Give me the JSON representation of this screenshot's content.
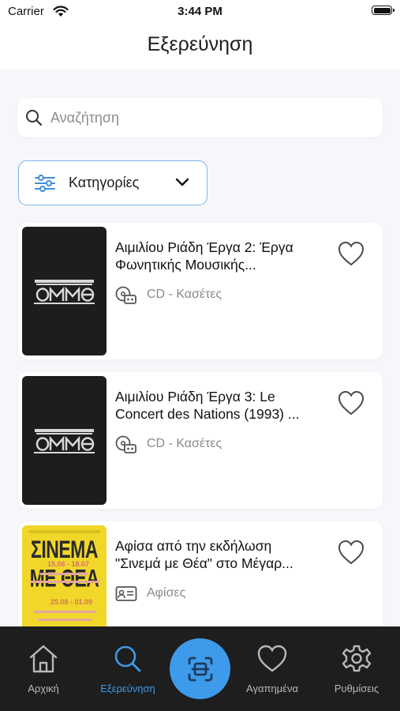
{
  "status_bar": {
    "carrier": "Carrier",
    "time": "3:44 PM"
  },
  "header": {
    "title": "Εξερεύνηση"
  },
  "search": {
    "placeholder": "Αναζήτηση",
    "icon": "search-icon"
  },
  "categories": {
    "label": "Κατηγορίες",
    "icon": "filter-sliders-icon",
    "chevron": "chevron-down-icon"
  },
  "items": [
    {
      "title_line1": "Αιμιλίου Ριάδη Έργα 2: Έργα",
      "title_line2": "Φωνητικής Μουσικής...",
      "category": "CD - Κασέτες",
      "category_icon": "cd-cassette-icon",
      "thumbnail": {
        "style": "dark",
        "logo": "ΟΜΜΘ"
      },
      "favorite": false
    },
    {
      "title_line1": "Αιμιλίου Ριάδη Έργα 3: Le",
      "title_line2": "Concert des Nations (1993) ...",
      "category": "CD - Κασέτες",
      "category_icon": "cd-cassette-icon",
      "thumbnail": {
        "style": "dark",
        "logo": "ΟΜΜΘ"
      },
      "favorite": false
    },
    {
      "title_line1": "Αφίσα από την εκδήλωση",
      "title_line2": "\"Σινεμά με Θέα\" στο Μέγαρ...",
      "category": "Αφίσες",
      "category_icon": "poster-card-icon",
      "thumbnail": {
        "style": "poster",
        "poster_title": "ΣΙΝΕΜΑ ΜΕ ΘΕΑ",
        "date1": "15.06 - 18.07",
        "date2": "25.08 - 01.09"
      },
      "favorite": false
    }
  ],
  "tabbar": {
    "tabs": [
      {
        "label": "Αρχική",
        "icon": "home-icon",
        "active": false
      },
      {
        "label": "Εξερεύνηση",
        "icon": "search-icon",
        "active": true
      },
      {
        "label": "Αγαπημένα",
        "icon": "heart-icon",
        "active": false
      },
      {
        "label": "Ρυθμίσεις",
        "icon": "gear-icon",
        "active": false
      }
    ],
    "center_button": {
      "icon": "scan-icon"
    }
  },
  "colors": {
    "accent": "#3e9aea",
    "tabbar_bg": "#1e1e1e",
    "background": "#f6f7fb",
    "poster_yellow": "#f1d72a"
  }
}
